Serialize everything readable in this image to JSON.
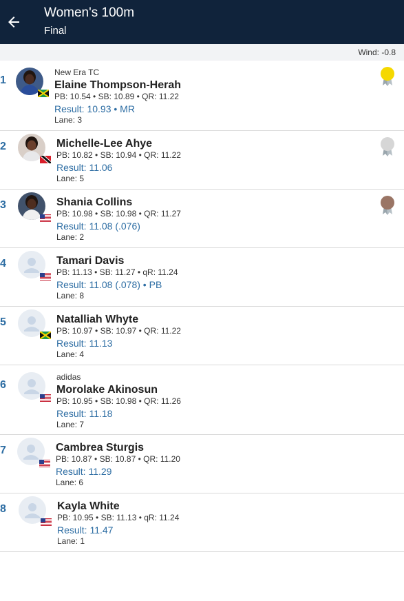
{
  "header": {
    "title": "Women's 100m",
    "subtitle": "Final",
    "bg_color": "#10233b"
  },
  "wind": "Wind: -0.8",
  "colors": {
    "accent": "#2d6da3",
    "gold": "#f5d800",
    "silver": "#d6d6d6",
    "bronze": "#9a7565"
  },
  "results": [
    {
      "rank": "1",
      "club": "New Era TC",
      "name": "Elaine Thompson-Herah",
      "marks": "PB: 10.54 • SB: 10.89 • QR: 11.22",
      "result": "Result: 10.93 • MR",
      "lane": "Lane: 3",
      "flag": "jamaica-flag",
      "photo": "photo",
      "medal": "gold"
    },
    {
      "rank": "2",
      "club": "",
      "name": "Michelle-Lee Ahye",
      "marks": "PB: 10.82 • SB: 10.94 • QR: 11.22",
      "result": "Result: 11.06",
      "lane": "Lane: 5",
      "flag": "trinidad-flag",
      "photo": "photo",
      "medal": "silver"
    },
    {
      "rank": "3",
      "club": "",
      "name": "Shania Collins",
      "marks": "PB: 10.98 • SB: 10.98 • QR: 11.27",
      "result": "Result: 11.08 (.076)",
      "lane": "Lane: 2",
      "flag": "usa-flag",
      "photo": "photo",
      "medal": "bronze"
    },
    {
      "rank": "4",
      "club": "",
      "name": "Tamari Davis",
      "marks": "PB: 11.13 • SB: 11.27 • qR: 11.24",
      "result": "Result: 11.08 (.078) • PB",
      "lane": "Lane: 8",
      "flag": "usa-flag",
      "photo": "placeholder",
      "medal": ""
    },
    {
      "rank": "5",
      "club": "",
      "name": "Natalliah Whyte",
      "marks": "PB: 10.97 • SB: 10.97 • QR: 11.22",
      "result": "Result: 11.13",
      "lane": "Lane: 4",
      "flag": "jamaica-flag",
      "photo": "placeholder",
      "medal": ""
    },
    {
      "rank": "6",
      "club": "adidas",
      "name": "Morolake Akinosun",
      "marks": "PB: 10.95 • SB: 10.98 • QR: 11.26",
      "result": "Result: 11.18",
      "lane": "Lane: 7",
      "flag": "usa-flag",
      "photo": "placeholder",
      "medal": ""
    },
    {
      "rank": "7",
      "club": "",
      "name": "Cambrea Sturgis",
      "marks": "PB: 10.87 • SB: 10.87 • QR: 11.20",
      "result": "Result: 11.29",
      "lane": "Lane: 6",
      "flag": "usa-flag",
      "photo": "placeholder",
      "medal": ""
    },
    {
      "rank": "8",
      "club": "",
      "name": "Kayla White",
      "marks": "PB: 10.95 • SB: 11.13 • qR: 11.24",
      "result": "Result: 11.47",
      "lane": "Lane: 1",
      "flag": "usa-flag",
      "photo": "placeholder",
      "medal": ""
    }
  ]
}
